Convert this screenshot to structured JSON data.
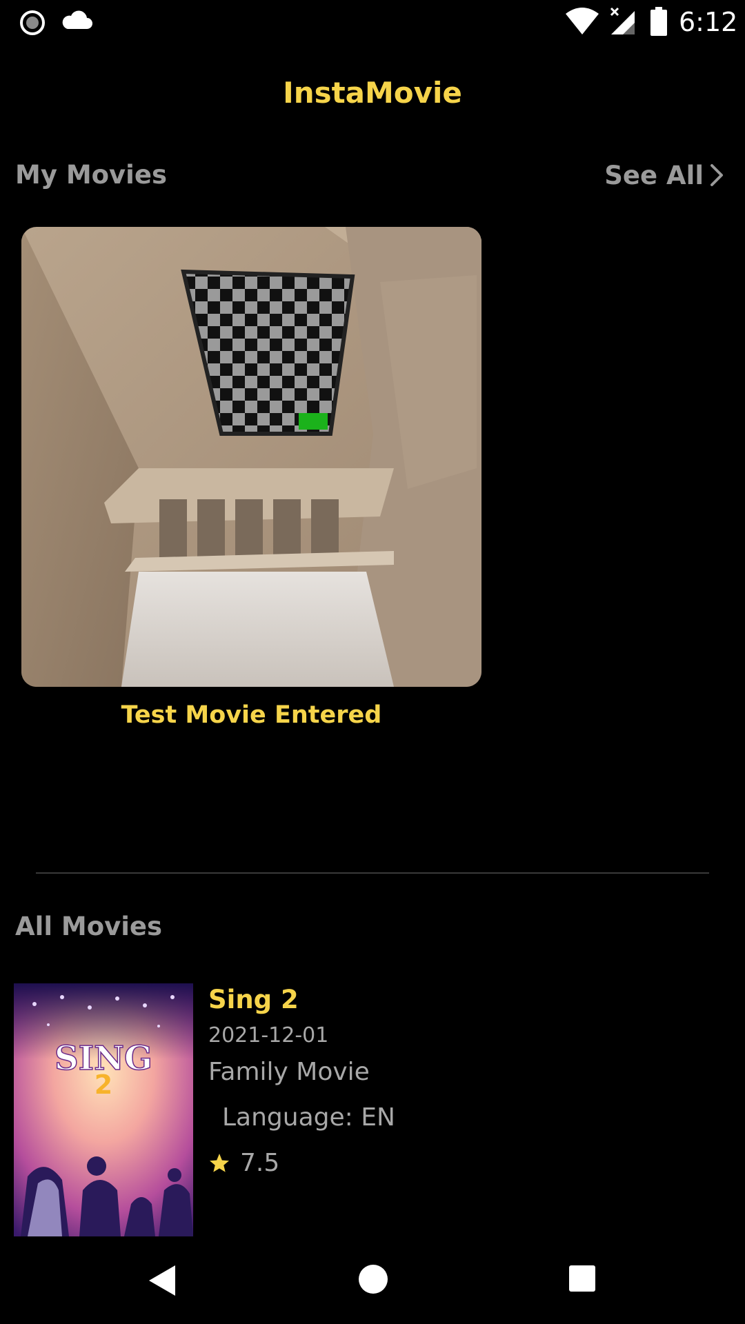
{
  "status_bar": {
    "time": "6:12",
    "icons": [
      "record-icon",
      "cloud-icon",
      "wifi-icon",
      "signal-icon",
      "battery-icon"
    ]
  },
  "app": {
    "title": "InstaMovie"
  },
  "my_movies": {
    "title": "My Movies",
    "see_all_label": "See All",
    "items": [
      {
        "title": "Test Movie Entered"
      }
    ]
  },
  "all_movies": {
    "title": "All Movies",
    "items": [
      {
        "title": "Sing 2",
        "release_date": "2021-12-01",
        "genre": "Family Movie",
        "language": "Language: EN",
        "rating": "7.5",
        "poster_text": "SING",
        "poster_number": "2"
      }
    ]
  },
  "nav_bar": {
    "buttons": [
      "back-icon",
      "home-icon",
      "recents-icon"
    ]
  },
  "colors": {
    "accent": "#f6d44a",
    "secondary_text": "#9a9a9a",
    "background": "#000000"
  }
}
